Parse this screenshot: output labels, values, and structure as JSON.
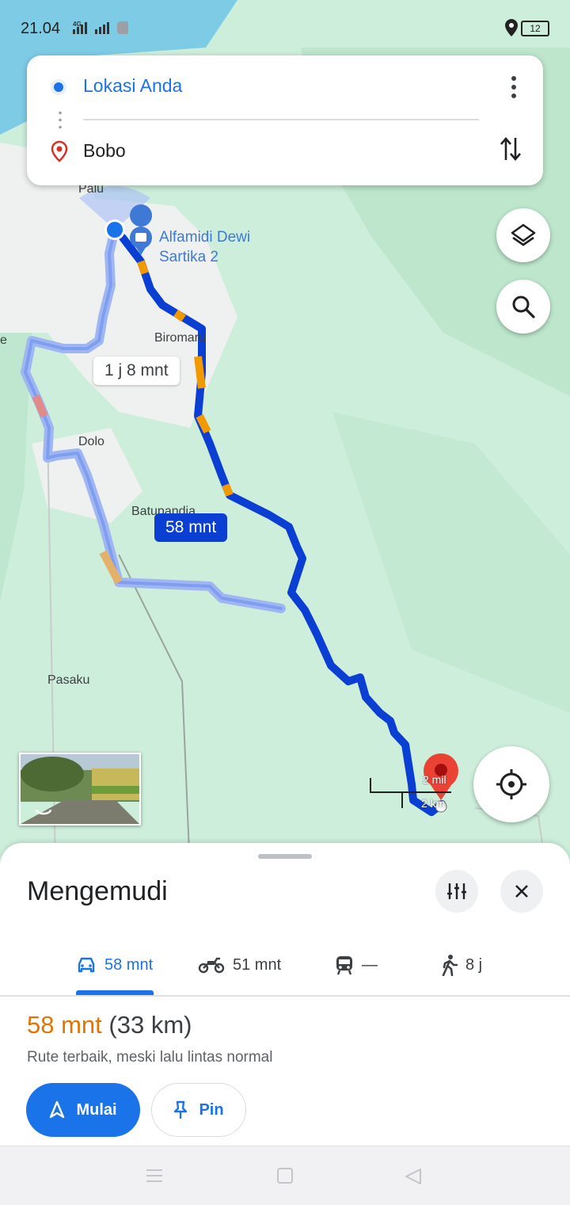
{
  "status_bar": {
    "time": "21.04",
    "network": "4G",
    "battery": "12"
  },
  "search": {
    "origin": "Lokasi Anda",
    "destination": "Bobo"
  },
  "map": {
    "labels": {
      "palu": "Palu",
      "biromaru": "Biromaru",
      "dolo": "Dolo",
      "batu": "Batupandia",
      "pasaku": "Pasaku",
      "edge": "e"
    },
    "poi": {
      "line1": "Alfamidi Dewi",
      "line2": "Sartika 2"
    },
    "alt_route_time": "1 j 8 mnt",
    "main_route_time": "58 mnt",
    "scale": {
      "miles": "2 mil",
      "km": "2 km"
    }
  },
  "sheet": {
    "title": "Mengemudi",
    "tabs": [
      {
        "mode": "car",
        "label": "58 mnt"
      },
      {
        "mode": "motorcycle",
        "label": "51 mnt"
      },
      {
        "mode": "transit",
        "label": "—"
      },
      {
        "mode": "walk",
        "label": "8 j"
      }
    ],
    "summary_duration": "58 mnt",
    "summary_distance": "(33 km)",
    "summary_note": "Rute terbaik, meski lalu lintas normal",
    "start_label": "Mulai",
    "pin_label": "Pin"
  },
  "colors": {
    "accent": "#1a73e8",
    "route": "#0b3fd4",
    "traffic": "#f29900",
    "duration": "#e37400"
  }
}
